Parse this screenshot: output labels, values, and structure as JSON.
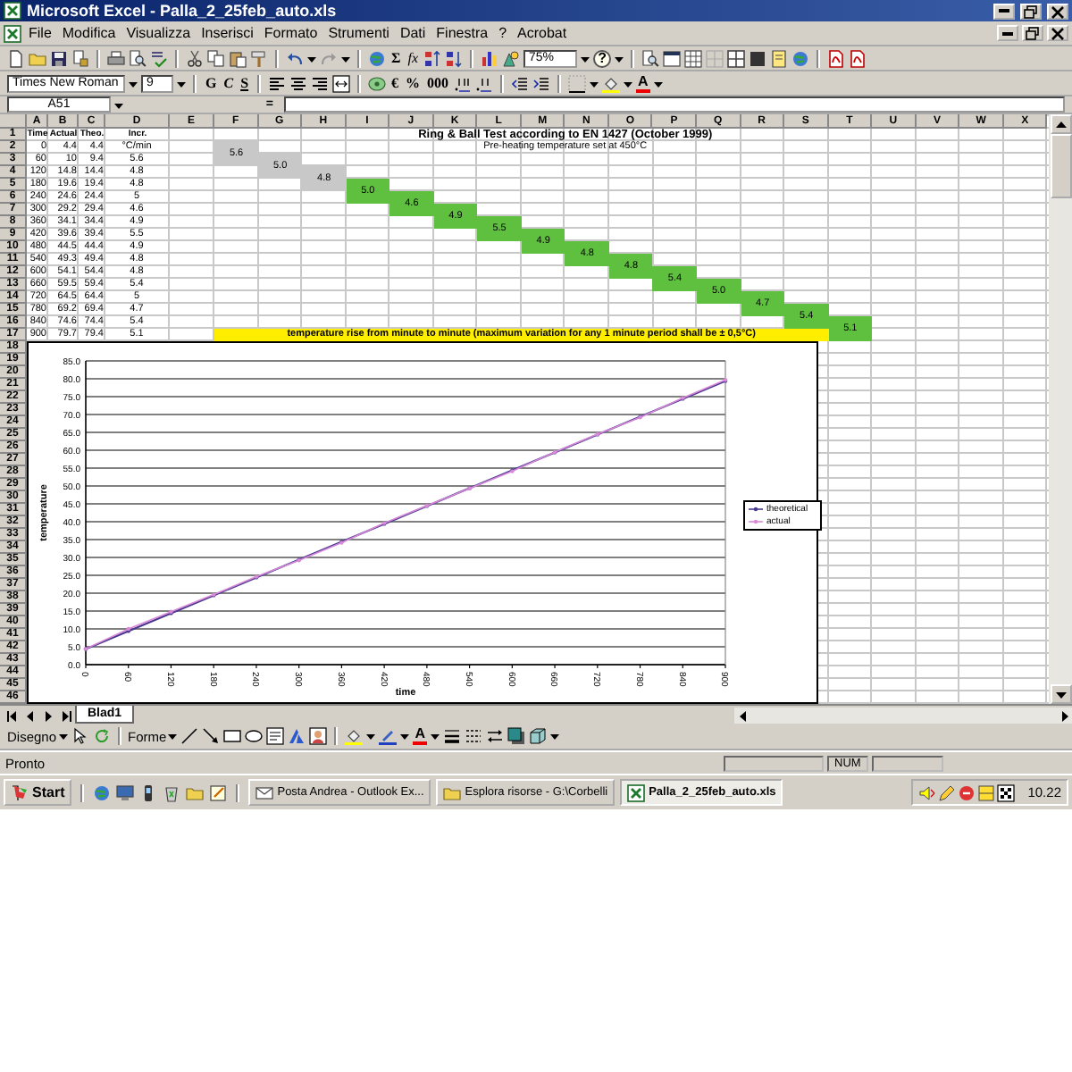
{
  "window": {
    "title": "Microsoft Excel - Palla_2_25feb_auto.xls"
  },
  "menu": [
    "File",
    "Modifica",
    "Visualizza",
    "Inserisci",
    "Formato",
    "Strumenti",
    "Dati",
    "Finestra",
    "?",
    "Acrobat"
  ],
  "toolbar": {
    "symbols": [
      "Σ",
      "fx"
    ],
    "zoom": "75%",
    "help": "?"
  },
  "format_toolbar": {
    "font": "Times New Roman",
    "size": "9",
    "styles": [
      "G",
      "C",
      "S"
    ],
    "number_formats": [
      "€",
      "%",
      "000"
    ],
    "font_color": "A"
  },
  "formula_bar": {
    "name_box": "A51",
    "equals": "="
  },
  "columns": [
    "A",
    "B",
    "C",
    "D",
    "E",
    "F",
    "G",
    "H",
    "I",
    "J",
    "K",
    "L",
    "M",
    "N",
    "O",
    "P",
    "Q",
    "R",
    "S",
    "T",
    "U",
    "V",
    "W",
    "X"
  ],
  "row_headers": [
    "1",
    "2",
    "3",
    "4",
    "5",
    "6",
    "7",
    "8",
    "9",
    "10",
    "11",
    "12",
    "13",
    "14",
    "15",
    "16",
    "17",
    "18",
    "19",
    "20",
    "21",
    "22",
    "23",
    "24",
    "25",
    "26",
    "27",
    "28",
    "29",
    "30",
    "31",
    "32",
    "33",
    "34",
    "35",
    "36",
    "37",
    "38",
    "39",
    "40",
    "41",
    "42",
    "43",
    "44",
    "45",
    "46"
  ],
  "table": {
    "header": [
      "Time",
      "Actual",
      "Theo.",
      "Incr."
    ],
    "rows": [
      [
        "0",
        "4.4",
        "4.4",
        "°C/min"
      ],
      [
        "60",
        "10",
        "9.4",
        "5.6"
      ],
      [
        "120",
        "14.8",
        "14.4",
        "4.8"
      ],
      [
        "180",
        "19.6",
        "19.4",
        "4.8"
      ],
      [
        "240",
        "24.6",
        "24.4",
        "5"
      ],
      [
        "300",
        "29.2",
        "29.4",
        "4.6"
      ],
      [
        "360",
        "34.1",
        "34.4",
        "4.9"
      ],
      [
        "420",
        "39.6",
        "39.4",
        "5.5"
      ],
      [
        "480",
        "44.5",
        "44.4",
        "4.9"
      ],
      [
        "540",
        "49.3",
        "49.4",
        "4.8"
      ],
      [
        "600",
        "54.1",
        "54.4",
        "4.8"
      ],
      [
        "660",
        "59.5",
        "59.4",
        "5.4"
      ],
      [
        "720",
        "64.5",
        "64.4",
        "5"
      ],
      [
        "780",
        "69.2",
        "69.4",
        "4.7"
      ],
      [
        "840",
        "74.6",
        "74.4",
        "5.4"
      ],
      [
        "900",
        "79.7",
        "79.4",
        "5.1"
      ]
    ]
  },
  "sheet_title": "Ring & Ball Test according to EN 1427 (October 1999)",
  "sheet_subtitle": "Pre-heating temperature set at 450°C",
  "increments": [
    {
      "value": "5.6",
      "color": "#c8c8c8"
    },
    {
      "value": "5.0",
      "color": "#c8c8c8"
    },
    {
      "value": "4.8",
      "color": "#c8c8c8"
    },
    {
      "value": "5.0",
      "color": "#5fc040"
    },
    {
      "value": "4.6",
      "color": "#5fc040"
    },
    {
      "value": "4.9",
      "color": "#5fc040"
    },
    {
      "value": "5.5",
      "color": "#5fc040"
    },
    {
      "value": "4.9",
      "color": "#5fc040"
    },
    {
      "value": "4.8",
      "color": "#5fc040"
    },
    {
      "value": "4.8",
      "color": "#5fc040"
    },
    {
      "value": "5.4",
      "color": "#5fc040"
    },
    {
      "value": "5.0",
      "color": "#5fc040"
    },
    {
      "value": "4.7",
      "color": "#5fc040"
    },
    {
      "value": "5.4",
      "color": "#5fc040"
    },
    {
      "value": "5.1",
      "color": "#5fc040"
    }
  ],
  "note": "temperature rise from minute to minute (maximum variation for any 1 minute period shall be ± 0,5°C)",
  "chart_data": {
    "type": "line",
    "xlabel": "time",
    "ylabel": "temperature",
    "x": [
      0,
      60,
      120,
      180,
      240,
      300,
      360,
      420,
      480,
      540,
      600,
      660,
      720,
      780,
      840,
      900
    ],
    "series": [
      {
        "name": "theoretical",
        "color": "#4a3890",
        "values": [
          4.4,
          9.4,
          14.4,
          19.4,
          24.4,
          29.4,
          34.4,
          39.4,
          44.4,
          49.4,
          54.4,
          59.4,
          64.4,
          69.4,
          74.4,
          79.4
        ]
      },
      {
        "name": "actual",
        "color": "#d88ad8",
        "values": [
          4.4,
          10,
          14.8,
          19.6,
          24.6,
          29.2,
          34.1,
          39.6,
          44.5,
          49.3,
          54.1,
          59.5,
          64.5,
          69.2,
          74.6,
          79.7
        ]
      }
    ],
    "xlim": [
      0,
      900
    ],
    "ylim": [
      0,
      85
    ],
    "grid": true,
    "legend": "right",
    "xticks": [
      0,
      60,
      120,
      180,
      240,
      300,
      360,
      420,
      480,
      540,
      600,
      660,
      720,
      780,
      840,
      900
    ],
    "yticks": [
      {
        "value": 0,
        "label": "0.0"
      },
      {
        "value": 5,
        "label": "5.0"
      },
      {
        "value": 10,
        "label": "10.0"
      },
      {
        "value": 15,
        "label": "15.0"
      },
      {
        "value": 20,
        "label": "20.0"
      },
      {
        "value": 25,
        "label": "25.0"
      },
      {
        "value": 30,
        "label": "30.0"
      },
      {
        "value": 35,
        "label": "35.0"
      },
      {
        "value": 40,
        "label": "40.0"
      },
      {
        "value": 45,
        "label": "45.0"
      },
      {
        "value": 50,
        "label": "50.0"
      },
      {
        "value": 55,
        "label": "55.0"
      },
      {
        "value": 60,
        "label": "60.0"
      },
      {
        "value": 65,
        "label": "65.0"
      },
      {
        "value": 70,
        "label": "70.0"
      },
      {
        "value": 75,
        "label": "75.0"
      },
      {
        "value": 80,
        "label": "80.0"
      },
      {
        "value": 85,
        "label": "85.0"
      }
    ]
  },
  "sheet_tabs": [
    {
      "label": "Blad1",
      "selected": true
    }
  ],
  "drawing_toolbar": {
    "draw": "Disegno",
    "shapes": "Forme",
    "font_color": "A"
  },
  "status_bar": {
    "text": "Pronto",
    "indicators": [
      "NUM"
    ]
  },
  "taskbar": {
    "start": "Start",
    "tasks": [
      {
        "label": "Posta Andrea - Outlook Ex...",
        "kind": "mail",
        "selected": false
      },
      {
        "label": "Esplora risorse - G:\\Corbelli",
        "kind": "folder",
        "selected": false
      },
      {
        "label": "Palla_2_25feb_auto.xls",
        "kind": "sheet",
        "selected": true
      }
    ],
    "clock": "10.22"
  }
}
